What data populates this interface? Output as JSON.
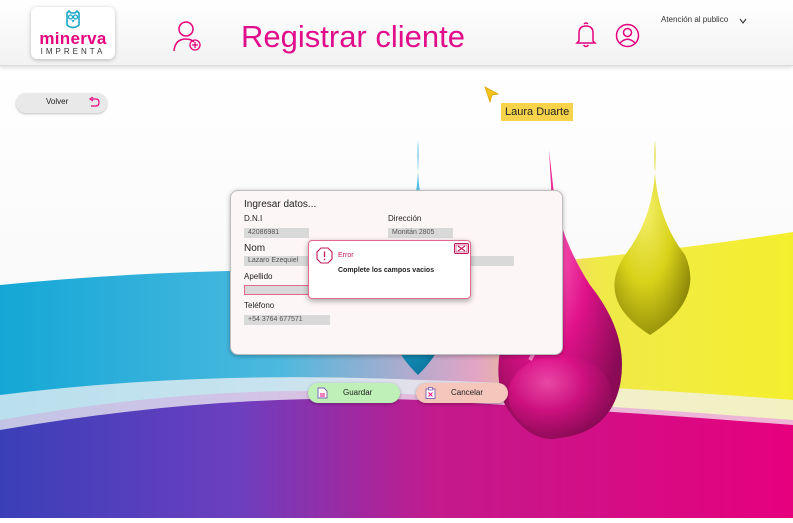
{
  "header": {
    "logo_name": "minerva",
    "logo_sub": "IMPRENTA",
    "title": "Registrar cliente",
    "role": "Atención al publico"
  },
  "nav": {
    "back_label": "Volver"
  },
  "presence": {
    "user_name": "Laura Duarte"
  },
  "form": {
    "title": "Ingresar datos...",
    "fields": {
      "dni": {
        "label": "D.N.I",
        "value": "42086981"
      },
      "direccion": {
        "label": "Dirección",
        "value": "Monitán 2805"
      },
      "nombre": {
        "label": "Nom",
        "value": "Lazaro Ezequiel"
      },
      "apellido": {
        "label": "Apellido",
        "value": ""
      },
      "telefono": {
        "label": "Teléfono",
        "value": "+54 3764 677571"
      }
    }
  },
  "error": {
    "title": "Error",
    "message": "Complete los campos vacios"
  },
  "actions": {
    "save_label": "Guardar",
    "cancel_label": "Cancelar"
  },
  "icons": {
    "logo": "owl-icon",
    "header_left": "user-add-icon",
    "notifications": "bell-icon",
    "profile": "profile-icon",
    "role_toggle": "chevron-down-icon",
    "back": "return-arrow-icon",
    "cursor": "cursor-arrow-icon",
    "error": "alert-octagon-icon",
    "close": "close-icon",
    "save": "save-document-icon",
    "cancel": "clipboard-cancel-icon"
  },
  "colors": {
    "brand": "#e6007e",
    "accent_teal": "#1aa6c8",
    "save_button": "#bff0b8",
    "cancel_button": "#f5c6bb",
    "user_tag": "#f6d34a"
  }
}
